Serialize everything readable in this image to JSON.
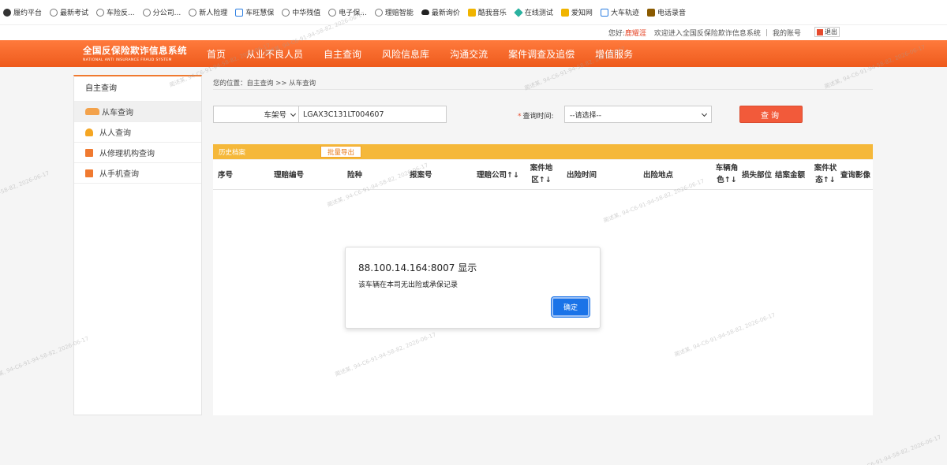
{
  "bookmarks": [
    {
      "label": "履约平台",
      "icon": "dark"
    },
    {
      "label": "最新考试",
      "icon": "grey"
    },
    {
      "label": "车险反...",
      "icon": "grey"
    },
    {
      "label": "分公司...",
      "icon": "grey"
    },
    {
      "label": "新人险理",
      "icon": "grey"
    },
    {
      "label": "车旺慧保",
      "icon": "blue"
    },
    {
      "label": "中华残值",
      "icon": "grey"
    },
    {
      "label": "电子保...",
      "icon": "grey"
    },
    {
      "label": "理赔智能",
      "icon": "grey"
    },
    {
      "label": "最新询价",
      "icon": "cloud"
    },
    {
      "label": "酷我音乐",
      "icon": "yellow"
    },
    {
      "label": "在线测试",
      "icon": "diamond"
    },
    {
      "label": "爱知网",
      "icon": "yellow"
    },
    {
      "label": "大车轨迹",
      "icon": "blue"
    },
    {
      "label": "电话录音",
      "icon": "brown"
    }
  ],
  "userbar": {
    "greeting": "您好:",
    "username": "鹿耀涯",
    "welcome": "欢迎进入全国反保险欺诈信息系统",
    "account": "我的账号",
    "logout": "退出"
  },
  "header": {
    "title_zh": "全国反保险欺诈信息系统",
    "title_en": "NATIONAL ANTI INSURANCE FRAUD SYSTEM",
    "nav": [
      "首页",
      "从业不良人员",
      "自主查询",
      "风险信息库",
      "沟通交流",
      "案件调查及追偿",
      "增值服务"
    ]
  },
  "sidebar": {
    "title": "自主查询",
    "items": [
      {
        "label": "从车查询",
        "icon": "car",
        "active": true
      },
      {
        "label": "从人查询",
        "icon": "person",
        "active": false
      },
      {
        "label": "从修理机构查询",
        "icon": "repair",
        "active": false
      },
      {
        "label": "从手机查询",
        "icon": "phone",
        "active": false
      }
    ]
  },
  "breadcrumb": "您的位置：自主查询 >> 从车查询",
  "search": {
    "type_selected": "车架号",
    "vin_value": "LGAX3C131LT004607",
    "time_label": "查询时间:",
    "time_selected": "--请选择--",
    "query_button": "查询"
  },
  "history": {
    "title": "历史档案",
    "export_button": "批量导出"
  },
  "table_headers": [
    "序号",
    "理赔编号",
    "险种",
    "报案号",
    "理赔公司↑↓",
    "案件地区↑↓",
    "出险时间",
    "出险地点",
    "车辆角色↑↓",
    "损失部位",
    "结案金额",
    "案件状态↑↓",
    "查询影像"
  ],
  "dialog": {
    "title": "88.100.14.164:8007 显示",
    "message": "该车辆在本司无出险或承保记录",
    "ok_button": "确定"
  },
  "watermark": "蔺述某, 94-C6-91-94-58-82, 2026-06-17",
  "colors": {
    "accent": "#ee5a1c",
    "history_bar": "#f5b83a",
    "query_button": "#f25a3a",
    "ok_button": "#1a73e8"
  }
}
